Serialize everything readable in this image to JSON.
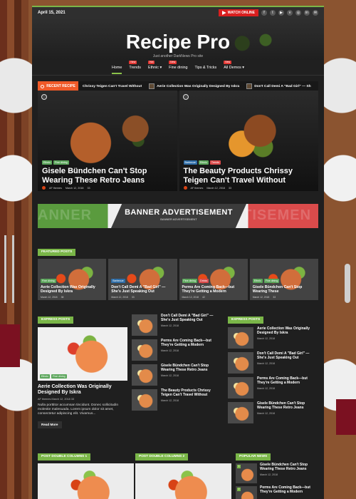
{
  "topbar": {
    "date": "April 15, 2021",
    "watch_online": "WATCH ONLINE",
    "social_icons": [
      "facebook-icon",
      "twitter-icon",
      "youtube-icon",
      "vimeo-icon",
      "instagram-icon",
      "linkedin-icon",
      "email-icon"
    ]
  },
  "site": {
    "title": "Recipe Pro",
    "tagline": "Just another DarkNews Pro site"
  },
  "nav": {
    "items": [
      {
        "label": "Home",
        "badge": ""
      },
      {
        "label": "Trends",
        "badge": "New"
      },
      {
        "label": "Ethnic",
        "badge": "Hot"
      },
      {
        "label": "Fine dining",
        "badge": "New"
      },
      {
        "label": "Tips & Tricks",
        "badge": ""
      },
      {
        "label": "All Demos",
        "badge": "New"
      }
    ]
  },
  "ticker": {
    "label": "RECENT RECIPE",
    "items": [
      "Chrissy Teigen Can't Travel Without",
      "Aerie Collection Was Originally Designed By Iskra",
      "Don't Call Demi A \"Bad Girl\" — Sh"
    ]
  },
  "featured": [
    {
      "tags": [
        "Ethnic",
        "Fine dining"
      ],
      "title": "Gisele Bündchen Can't Stop Wearing These Retro Jeans",
      "author": "AF themes",
      "date": "March 12, 2018",
      "views": "33"
    },
    {
      "tags": [
        "Barbecue",
        "Ethnic",
        "Trends"
      ],
      "title": "The Beauty Products Chrissy Teigen Can't Travel Without",
      "author": "AF themes",
      "date": "March 12, 2018",
      "views": "33"
    }
  ],
  "banner": {
    "ghost_left": "ANNER",
    "ghost_right": "RTISEMEN",
    "title": "BANNER ADVERTISEMENT",
    "subtitle": "BANNER ADVERTISEMENT"
  },
  "featured_posts": {
    "label": "FEATURED POSTS",
    "items": [
      {
        "tags": [
          "Fine dining"
        ],
        "title": "Aerie Collection Was Originally Designed By Iskra",
        "date": "March 12, 2018",
        "views": "38"
      },
      {
        "tags": [
          "Barbecue"
        ],
        "title": "Don't Call Demi A \"Bad Girl\" — She's Just Speaking Out",
        "date": "March 12, 2018",
        "views": "33"
      },
      {
        "tags": [
          "Fine dining",
          "Drinks"
        ],
        "title": "Perms Are Coming Back—but They're Getting a Modern",
        "date": "March 12, 2018",
        "views": "42"
      },
      {
        "tags": [
          "Ethnic",
          "Fine dining"
        ],
        "title": "Gisele Bündchen Can't Stop Wearing These",
        "date": "March 12, 2018",
        "views": "33"
      }
    ]
  },
  "express_left": {
    "label": "EXPRESS POSTS",
    "big_tags": [
      "Ethnic",
      "Fine dining"
    ],
    "title": "Aerie Collection Was Originally Designed By Iskra",
    "meta": "AF themes   March 12, 2018   33",
    "excerpt": "Nulla porttitor accumsan tincidunt. Donec sollicitudin molestie malesuada. Lorem ipsum dolor sit amet, consectetur adipiscing elit. Vivamus...",
    "readmore": "Read More"
  },
  "express_mid": {
    "items": [
      {
        "title": "Don't Call Demi A \"Bad Girl\" — She's Just Speaking Out",
        "date": "March 12, 2018"
      },
      {
        "title": "Perms Are Coming Back—but They're Getting a Modern",
        "date": "March 12, 2018"
      },
      {
        "title": "Gisele Bündchen Can't Stop Wearing These Retro Jeans",
        "date": "March 12, 2018"
      },
      {
        "title": "The Beauty Products Chrissy Teigen Can't Travel Without",
        "date": "March 12, 2018"
      }
    ]
  },
  "express_right": {
    "label": "EXPRESS POSTS",
    "items": [
      {
        "title": "Aerie Collection Was Originally Designed By Iskra",
        "date": "March 12, 2018"
      },
      {
        "title": "Don't Call Demi A \"Bad Girl\" — She's Just Speaking Out",
        "date": "March 12, 2018"
      },
      {
        "title": "Perms Are Coming Back—but They're Getting a Modern",
        "date": "March 12, 2018"
      },
      {
        "title": "Gisele Bündchen Can't Stop Wearing These Retro Jeans",
        "date": "March 12, 2018"
      }
    ]
  },
  "bottom": {
    "double1": "POST DOUBLE COLUMNS 1",
    "double2": "POST DOUBLE COLUMNS 2",
    "popular": "POPULAR NEWS",
    "popular_items": [
      {
        "num": "1",
        "title": "Gisele Bündchen Can't Stop Wearing These Retro Jeans",
        "date": "March 12, 2018"
      },
      {
        "num": "2",
        "title": "Perms Are Coming Back—but They're Getting a Modern",
        "date": ""
      }
    ]
  }
}
